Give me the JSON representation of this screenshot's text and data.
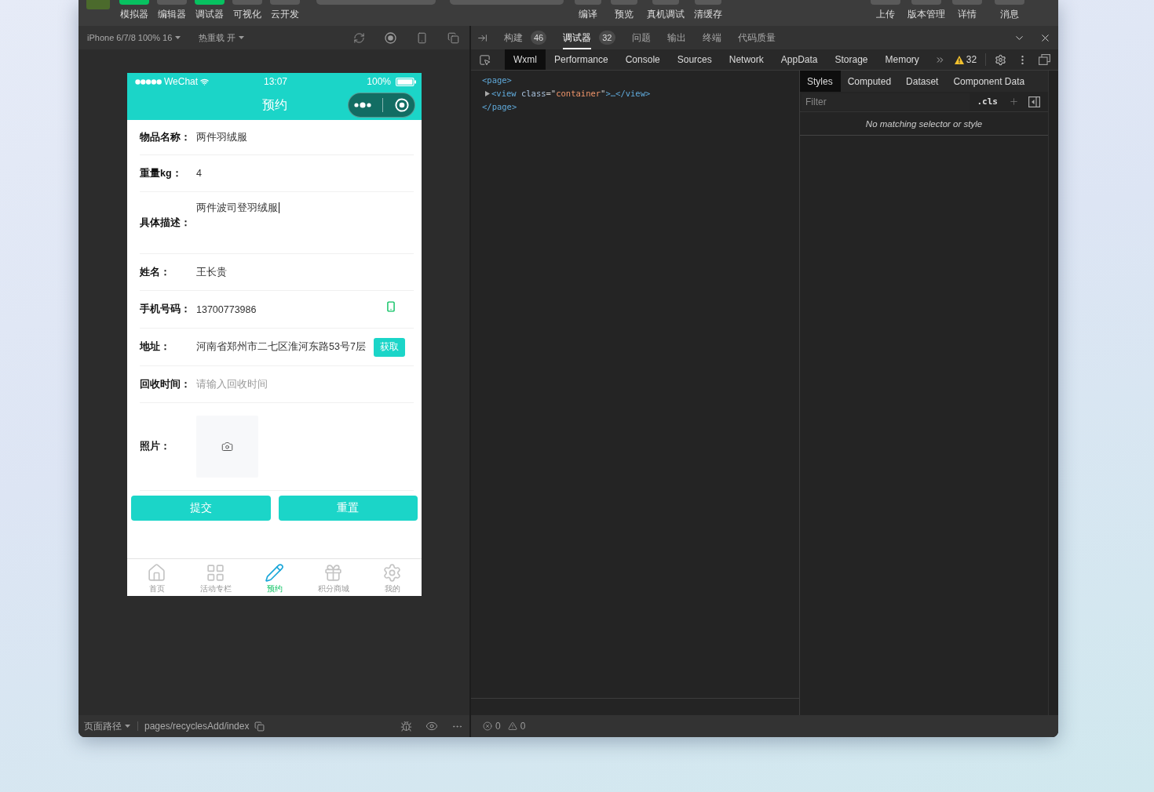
{
  "toolbar": {
    "tools": [
      {
        "label": "模拟器",
        "on": true
      },
      {
        "label": "编辑器",
        "on": false
      },
      {
        "label": "调试器",
        "on": true
      },
      {
        "label": "可视化",
        "on": false
      },
      {
        "label": "云开发",
        "on": false
      }
    ],
    "actions": [
      "编译",
      "预览",
      "真机调试",
      "清缓存"
    ],
    "right_actions": [
      "上传",
      "版本管理",
      "详情",
      "消息"
    ]
  },
  "simulator": {
    "device": "iPhone 6/7/8 100% 16",
    "hot_reload": "热重载 开"
  },
  "phone": {
    "status_bar": {
      "carrier": "WeChat",
      "time": "13:07",
      "battery": "100%"
    },
    "title": "预约",
    "form": [
      {
        "kind": "text",
        "label": "物品名称：",
        "value": "两件羽绒服"
      },
      {
        "kind": "text",
        "label": "重量kg：",
        "value": "4"
      },
      {
        "kind": "textarea",
        "label": "具体描述：",
        "value": "两件波司登羽绒服",
        "focused": true
      },
      {
        "kind": "text",
        "label": "姓名：",
        "value": "王长贵"
      },
      {
        "kind": "phone",
        "label": "手机号码：",
        "value": "13700773986"
      },
      {
        "kind": "address",
        "label": "地址：",
        "value": "河南省郑州市二七区淮河东路53号7层",
        "button": "获取"
      },
      {
        "kind": "text",
        "label": "回收时间：",
        "placeholder": "请输入回收时间"
      },
      {
        "kind": "photo",
        "label": "照片："
      }
    ],
    "buttons": [
      "提交",
      "重置"
    ],
    "tab_bar": [
      {
        "label": "首页",
        "selected": false
      },
      {
        "label": "活动专栏",
        "selected": false
      },
      {
        "label": "预约",
        "selected": true
      },
      {
        "label": "积分商城",
        "selected": false
      },
      {
        "label": "我的",
        "selected": false
      }
    ]
  },
  "page_path": {
    "label": "页面路径",
    "path": "pages/recyclesAdd/index"
  },
  "devtools": {
    "tabs": [
      {
        "label": "构建",
        "count": "46",
        "selected": false
      },
      {
        "label": "调试器",
        "count": "32",
        "selected": true
      },
      {
        "label": "问题",
        "selected": false
      },
      {
        "label": "输出",
        "selected": false
      },
      {
        "label": "终端",
        "selected": false
      },
      {
        "label": "代码质量",
        "selected": false
      }
    ],
    "panel_tabs": [
      {
        "label": "Wxml",
        "selected": true
      },
      {
        "label": "Performance",
        "selected": false
      },
      {
        "label": "Console",
        "selected": false
      },
      {
        "label": "Sources",
        "selected": false
      },
      {
        "label": "Network",
        "selected": false
      },
      {
        "label": "AppData",
        "selected": false
      },
      {
        "label": "Storage",
        "selected": false
      },
      {
        "label": "Memory",
        "selected": false
      }
    ],
    "warning_count": "32",
    "wxml": {
      "open": "<page>",
      "close": "</page>",
      "children": [
        {
          "expanded": false,
          "segments": [
            {
              "kind": "tag",
              "text": "<view"
            },
            {
              "kind": "attr",
              "text": " class"
            },
            {
              "kind": "punct",
              "text": "=\""
            },
            {
              "kind": "value",
              "text": "container"
            },
            {
              "kind": "punct",
              "text": "\""
            },
            {
              "kind": "tag",
              "text": ">…</view>"
            }
          ]
        }
      ]
    },
    "styles_tabs": [
      {
        "label": "Styles",
        "selected": true
      },
      {
        "label": "Computed",
        "selected": false
      },
      {
        "label": "Dataset",
        "selected": false
      },
      {
        "label": "Component Data",
        "selected": false
      }
    ],
    "filter": {
      "placeholder": "Filter",
      "cls": ".cls"
    },
    "styles_message": "No matching selector or style",
    "console_status": {
      "errors": "0",
      "warnings": "0"
    }
  }
}
